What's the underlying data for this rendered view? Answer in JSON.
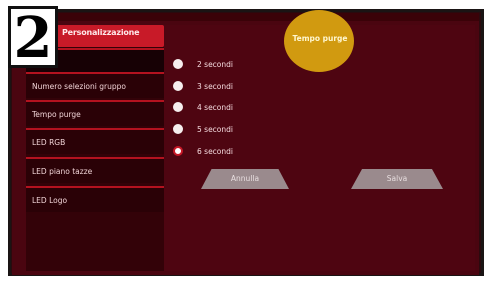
{
  "callout_number": "2",
  "menu": {
    "header": "Personalizzazione",
    "items": [
      {
        "label": ""
      },
      {
        "label": "Numero selezioni gruppo"
      },
      {
        "label": "Tempo purge"
      },
      {
        "label": "LED RGB"
      },
      {
        "label": "LED piano tazze"
      },
      {
        "label": "LED Logo"
      }
    ]
  },
  "panel": {
    "title": "Tempo purge",
    "options": [
      {
        "label": "2 secondi",
        "selected": false
      },
      {
        "label": "3 secondi",
        "selected": false
      },
      {
        "label": "4 secondi",
        "selected": false
      },
      {
        "label": "5 secondi",
        "selected": false
      },
      {
        "label": "6 secondi",
        "selected": true
      }
    ],
    "cancel_label": "Annulla",
    "save_label": "Salva"
  },
  "colors": {
    "accent": "#c81a28",
    "panel_bg": "#4e0511",
    "highlight": "#d19a10"
  }
}
